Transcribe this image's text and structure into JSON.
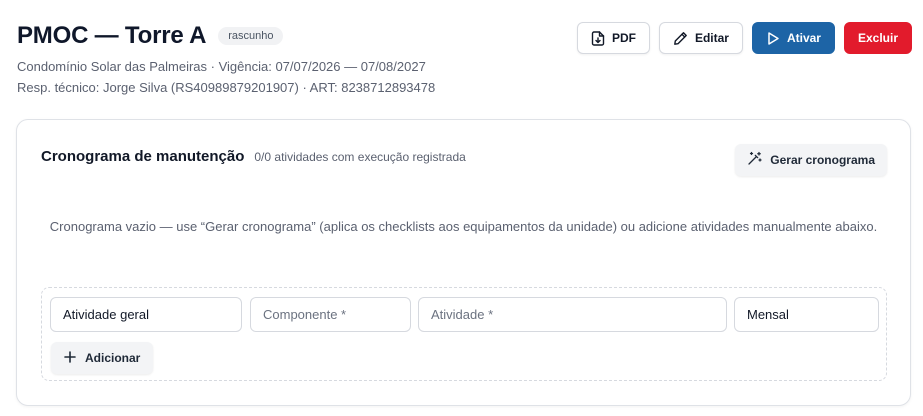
{
  "header": {
    "title": "PMOC — Torre A",
    "status_badge": "rascunho",
    "meta_line1": "Condomínio Solar das Palmeiras · Vigência: 07/07/2026 — 07/08/2027",
    "meta_line2": "Resp. técnico: Jorge Silva (RS40989879201907) · ART: 8238712893478"
  },
  "actions": {
    "pdf_label": "PDF",
    "edit_label": "Editar",
    "activate_label": "Ativar",
    "delete_label": "Excluir"
  },
  "colors": {
    "primary": "#1d64a6",
    "danger": "#e21b2c"
  },
  "schedule": {
    "title": "Cronograma de manutenção",
    "subtitle": "0/0 atividades com execução registrada",
    "generate_label": "Gerar cronograma",
    "empty_message": "Cronograma vazio — use “Gerar cronograma” (aplica os checklists aos equipamentos da unidade) ou adicione atividades manualmente abaixo.",
    "form": {
      "type_value": "Atividade geral",
      "component_placeholder": "Componente *",
      "activity_placeholder": "Atividade *",
      "frequency_value": "Mensal",
      "add_label": "Adicionar"
    }
  },
  "icons": [
    "file-download-icon",
    "pencil-icon",
    "play-icon",
    "magic-wand-icon",
    "plus-icon"
  ]
}
